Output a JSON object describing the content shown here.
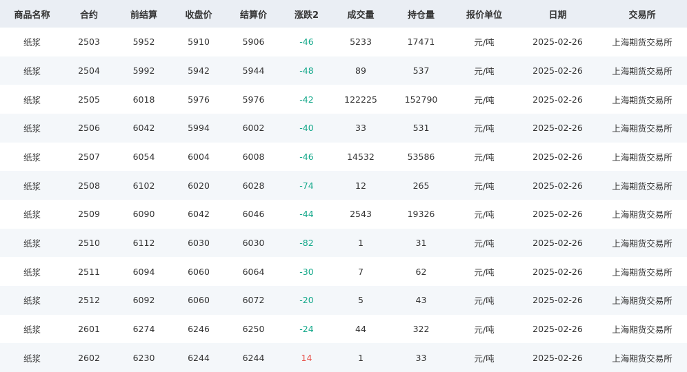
{
  "colors": {
    "header_bg": "#eaeef4",
    "stripe_bg": "#f4f7fa",
    "down": "#14a88a",
    "up": "#e8554e"
  },
  "columns": [
    "商品名称",
    "合约",
    "前结算",
    "收盘价",
    "结算价",
    "涨跌2",
    "成交量",
    "持仓量",
    "报价单位",
    "日期",
    "交易所"
  ],
  "rows": [
    [
      "纸浆",
      "2503",
      "5952",
      "5910",
      "5906",
      "-46",
      "5233",
      "17471",
      "元/吨",
      "2025-02-26",
      "上海期货交易所"
    ],
    [
      "纸浆",
      "2504",
      "5992",
      "5942",
      "5944",
      "-48",
      "89",
      "537",
      "元/吨",
      "2025-02-26",
      "上海期货交易所"
    ],
    [
      "纸浆",
      "2505",
      "6018",
      "5976",
      "5976",
      "-42",
      "122225",
      "152790",
      "元/吨",
      "2025-02-26",
      "上海期货交易所"
    ],
    [
      "纸浆",
      "2506",
      "6042",
      "5994",
      "6002",
      "-40",
      "33",
      "531",
      "元/吨",
      "2025-02-26",
      "上海期货交易所"
    ],
    [
      "纸浆",
      "2507",
      "6054",
      "6004",
      "6008",
      "-46",
      "14532",
      "53586",
      "元/吨",
      "2025-02-26",
      "上海期货交易所"
    ],
    [
      "纸浆",
      "2508",
      "6102",
      "6020",
      "6028",
      "-74",
      "12",
      "265",
      "元/吨",
      "2025-02-26",
      "上海期货交易所"
    ],
    [
      "纸浆",
      "2509",
      "6090",
      "6042",
      "6046",
      "-44",
      "2543",
      "19326",
      "元/吨",
      "2025-02-26",
      "上海期货交易所"
    ],
    [
      "纸浆",
      "2510",
      "6112",
      "6030",
      "6030",
      "-82",
      "1",
      "31",
      "元/吨",
      "2025-02-26",
      "上海期货交易所"
    ],
    [
      "纸浆",
      "2511",
      "6094",
      "6060",
      "6064",
      "-30",
      "7",
      "62",
      "元/吨",
      "2025-02-26",
      "上海期货交易所"
    ],
    [
      "纸浆",
      "2512",
      "6092",
      "6060",
      "6072",
      "-20",
      "5",
      "43",
      "元/吨",
      "2025-02-26",
      "上海期货交易所"
    ],
    [
      "纸浆",
      "2601",
      "6274",
      "6246",
      "6250",
      "-24",
      "44",
      "322",
      "元/吨",
      "2025-02-26",
      "上海期货交易所"
    ],
    [
      "纸浆",
      "2602",
      "6230",
      "6244",
      "6244",
      "14",
      "1",
      "33",
      "元/吨",
      "2025-02-26",
      "上海期货交易所"
    ]
  ]
}
